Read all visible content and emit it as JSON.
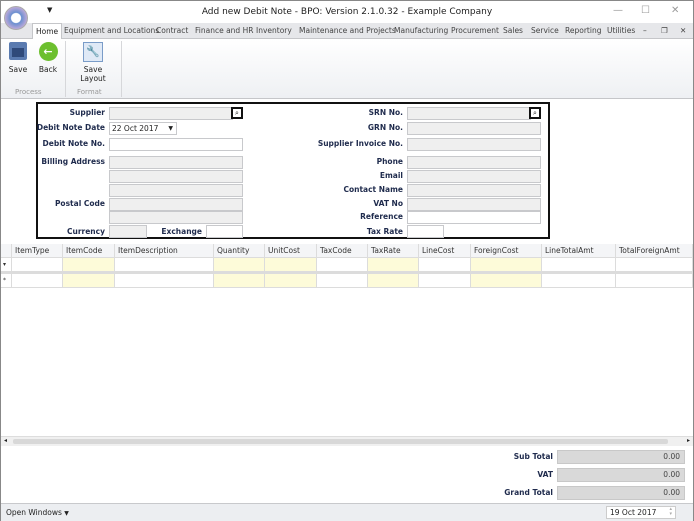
{
  "window": {
    "title": "Add new Debit Note - BPO: Version 2.1.0.32 - Example Company"
  },
  "tabs": [
    "Home",
    "Equipment and Locations",
    "Contract",
    "Finance and HR",
    "Inventory",
    "Maintenance and Projects",
    "Manufacturing",
    "Procurement",
    "Sales",
    "Service",
    "Reporting",
    "Utilities"
  ],
  "ribbon": {
    "save": "Save",
    "back": "Back",
    "save_layout": "Save Layout",
    "group_process": "Process",
    "group_format": "Format"
  },
  "form": {
    "supplier_label": "Supplier",
    "date_label": "Debit Note Date",
    "date_value": "22 Oct 2017",
    "debit_no_label": "Debit Note No.",
    "billing_label": "Billing Address",
    "postal_label": "Postal Code",
    "currency_label": "Currency",
    "exchange_label": "Exchange",
    "srn_label": "SRN No.",
    "grn_label": "GRN No.",
    "invoice_label": "Supplier Invoice No.",
    "phone_label": "Phone",
    "email_label": "Email",
    "contact_label": "Contact Name",
    "vat_label": "VAT No",
    "reference_label": "Reference",
    "taxrate_label": "Tax Rate"
  },
  "grid": {
    "columns": [
      "ItemType",
      "ItemCode",
      "ItemDescription",
      "Quantity",
      "UnitCost",
      "TaxCode",
      "TaxRate",
      "LineCost",
      "ForeignCost",
      "LineTotalAmt",
      "TotalForeignAmt"
    ],
    "row_indicators": [
      "▾",
      "*"
    ]
  },
  "totals": {
    "sub_total_label": "Sub Total",
    "sub_total": "0.00",
    "vat_label": "VAT",
    "vat": "0.00",
    "grand_total_label": "Grand Total",
    "grand_total": "0.00"
  },
  "status": {
    "open_windows": "Open Windows",
    "date": "19 Oct 2017"
  }
}
